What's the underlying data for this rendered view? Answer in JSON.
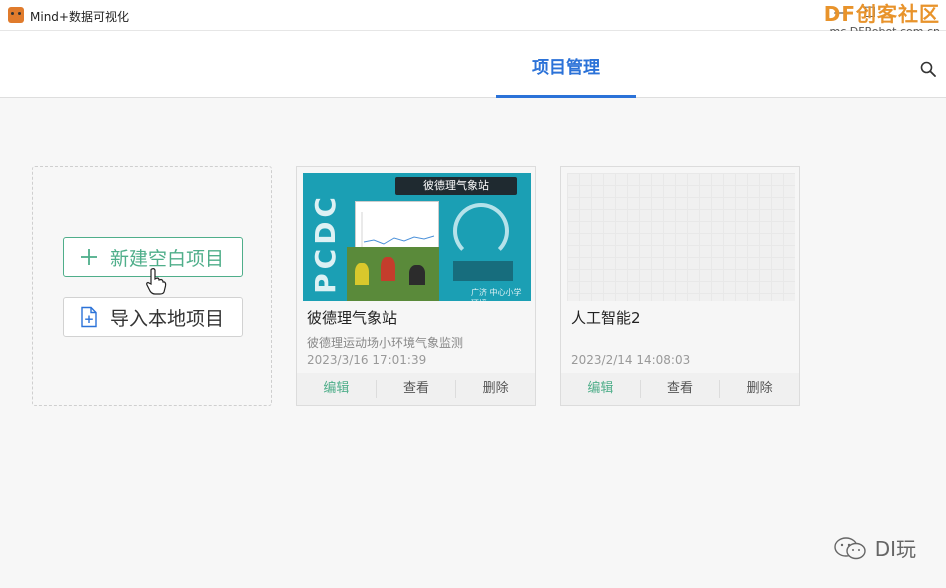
{
  "window": {
    "title": "Mind+数据可视化",
    "controls": {
      "minimize": "—",
      "maximize": "☐",
      "close": "✕"
    }
  },
  "watermark": {
    "brand": "DF创客社区",
    "site": "mc.DFRobot.com.cn"
  },
  "header": {
    "tab_label": "项目管理",
    "accent": "#2b72d8"
  },
  "actions": {
    "new_project": "新建空白项目",
    "import_project": "导入本地项目",
    "accent": "#4fae8a"
  },
  "projects": [
    {
      "name": "彼德理气象站",
      "description": "彼德理运动场小环境气象监测",
      "date": "2023/3/16 17:01:39",
      "thumbnail": {
        "label": "彼德理气象站",
        "letters": "PCDC",
        "footer": "广济 中心小学 环境"
      },
      "edit": "编辑",
      "view": "查看",
      "delete": "删除"
    },
    {
      "name": "人工智能2",
      "description": "",
      "date": "2023/2/14 14:08:03",
      "edit": "编辑",
      "view": "查看",
      "delete": "删除"
    }
  ],
  "footer_watermark": {
    "text": "DI玩",
    "icon": "wechat-icon"
  }
}
